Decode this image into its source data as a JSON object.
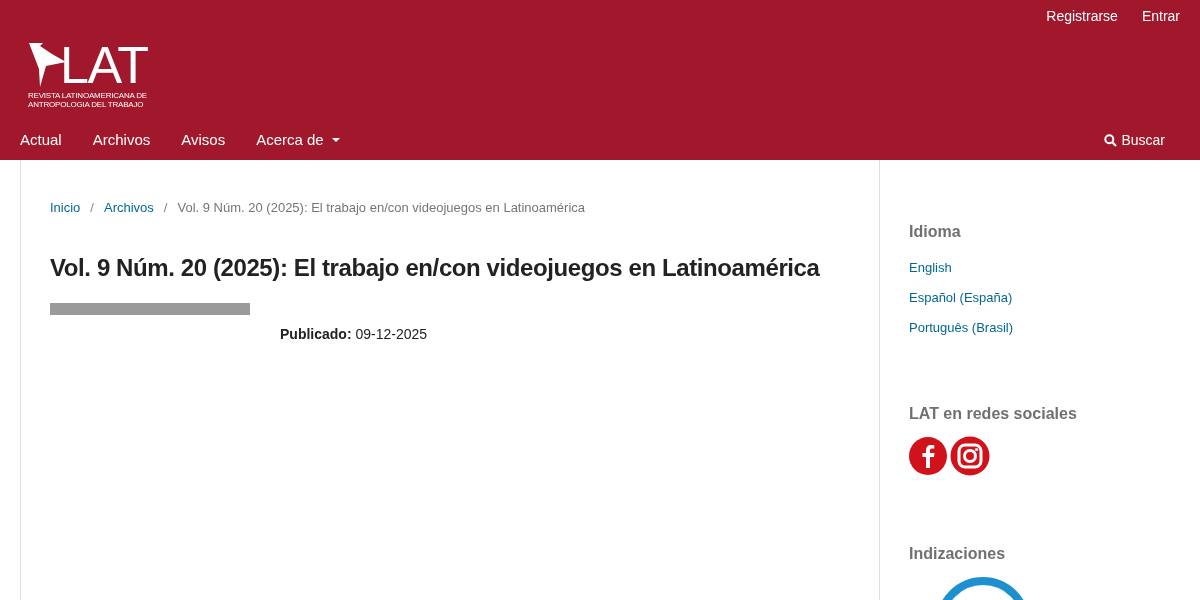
{
  "user_nav": [
    "Registrarse",
    "Entrar"
  ],
  "logo": {
    "mark": "LAT",
    "subtitle": "REVISTA LATINOAMERICANA DE ANTROPOLOGIA DEL TRABAJO"
  },
  "main_nav": [
    {
      "label": "Actual",
      "has_menu": false
    },
    {
      "label": "Archivos",
      "has_menu": false
    },
    {
      "label": "Avisos",
      "has_menu": false
    },
    {
      "label": "Acerca de",
      "has_menu": true
    }
  ],
  "search": "Buscar",
  "breadcrumb_separator": "/",
  "breadcrumb": [
    {
      "label": "Inicio",
      "current": false
    },
    {
      "label": "Archivos",
      "current": false
    },
    {
      "label": "Vol. 9 Núm. 20 (2025): El trabajo en/con videojuegos en Latinoamérica",
      "current": true
    }
  ],
  "title": "Vol. 9 Núm. 20 (2025): El trabajo en/con videojuegos en Latinoamérica",
  "published": {
    "label": "Publicado:",
    "value": "09-12-2025"
  },
  "sidebar": {
    "language": {
      "title": "Idioma",
      "items": [
        "English",
        "Español (España)",
        "Português (Brasil)"
      ]
    },
    "social": {
      "title": "LAT en redes sociales",
      "items": [
        {
          "kind": "facebook"
        },
        {
          "kind": "instagram"
        }
      ]
    },
    "indexing": {
      "title": "Indizaciones"
    }
  }
}
